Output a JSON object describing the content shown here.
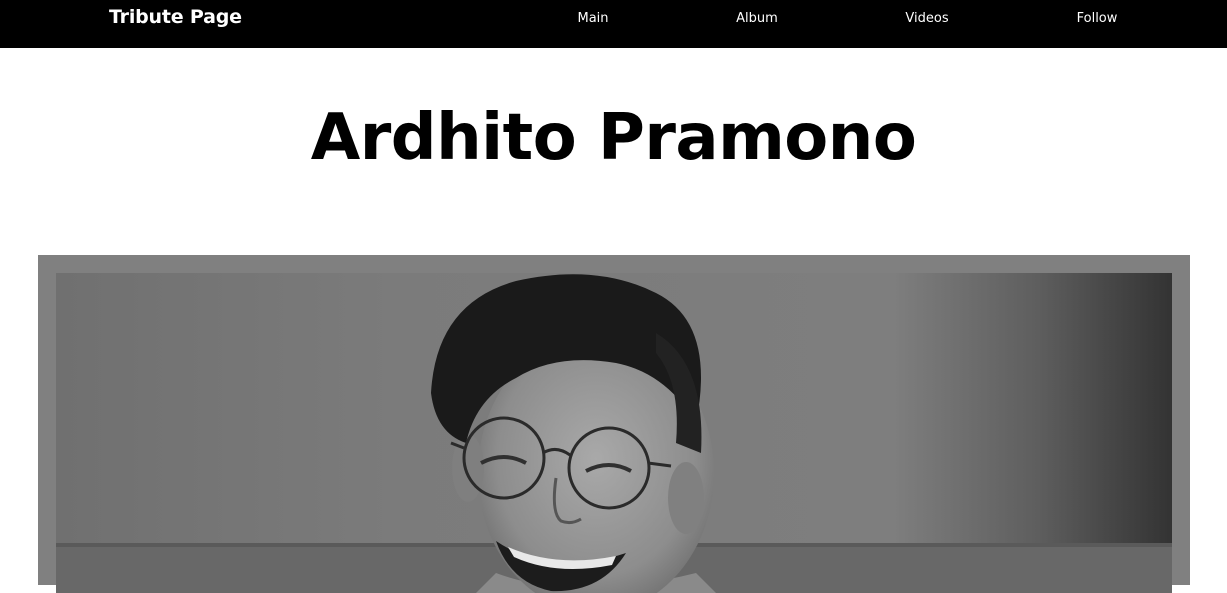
{
  "navbar": {
    "brand": "Tribute Page",
    "links": [
      {
        "label": "Main"
      },
      {
        "label": "Album"
      },
      {
        "label": "Videos"
      },
      {
        "label": "Follow"
      }
    ]
  },
  "header": {
    "title": "Ardhito Pramono"
  },
  "photo": {
    "description": "black-and-white portrait photo"
  },
  "colors": {
    "navbar_bg": "#000000",
    "nav_text": "#ffffff",
    "frame": "#808080",
    "page_bg": "#ffffff"
  }
}
